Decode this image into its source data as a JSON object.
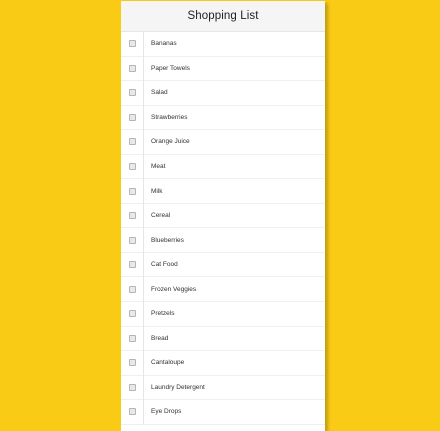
{
  "page": {
    "background_color": "#facb14"
  },
  "header": {
    "title": "Shopping List"
  },
  "items": [
    {
      "label": "Bananas",
      "checked": false
    },
    {
      "label": "Paper Towels",
      "checked": false
    },
    {
      "label": "Salad",
      "checked": false
    },
    {
      "label": "Strawberries",
      "checked": false
    },
    {
      "label": "Orange Juice",
      "checked": false
    },
    {
      "label": "Meat",
      "checked": false
    },
    {
      "label": "Milk",
      "checked": false
    },
    {
      "label": "Cereal",
      "checked": false
    },
    {
      "label": "Blueberries",
      "checked": false
    },
    {
      "label": "Cat Food",
      "checked": false
    },
    {
      "label": "Frozen Veggies",
      "checked": false
    },
    {
      "label": "Pretzels",
      "checked": false
    },
    {
      "label": "Bread",
      "checked": false
    },
    {
      "label": "Cantaloupe",
      "checked": false
    },
    {
      "label": "Laundry Detergent",
      "checked": false
    },
    {
      "label": "Eye Drops",
      "checked": false
    }
  ]
}
